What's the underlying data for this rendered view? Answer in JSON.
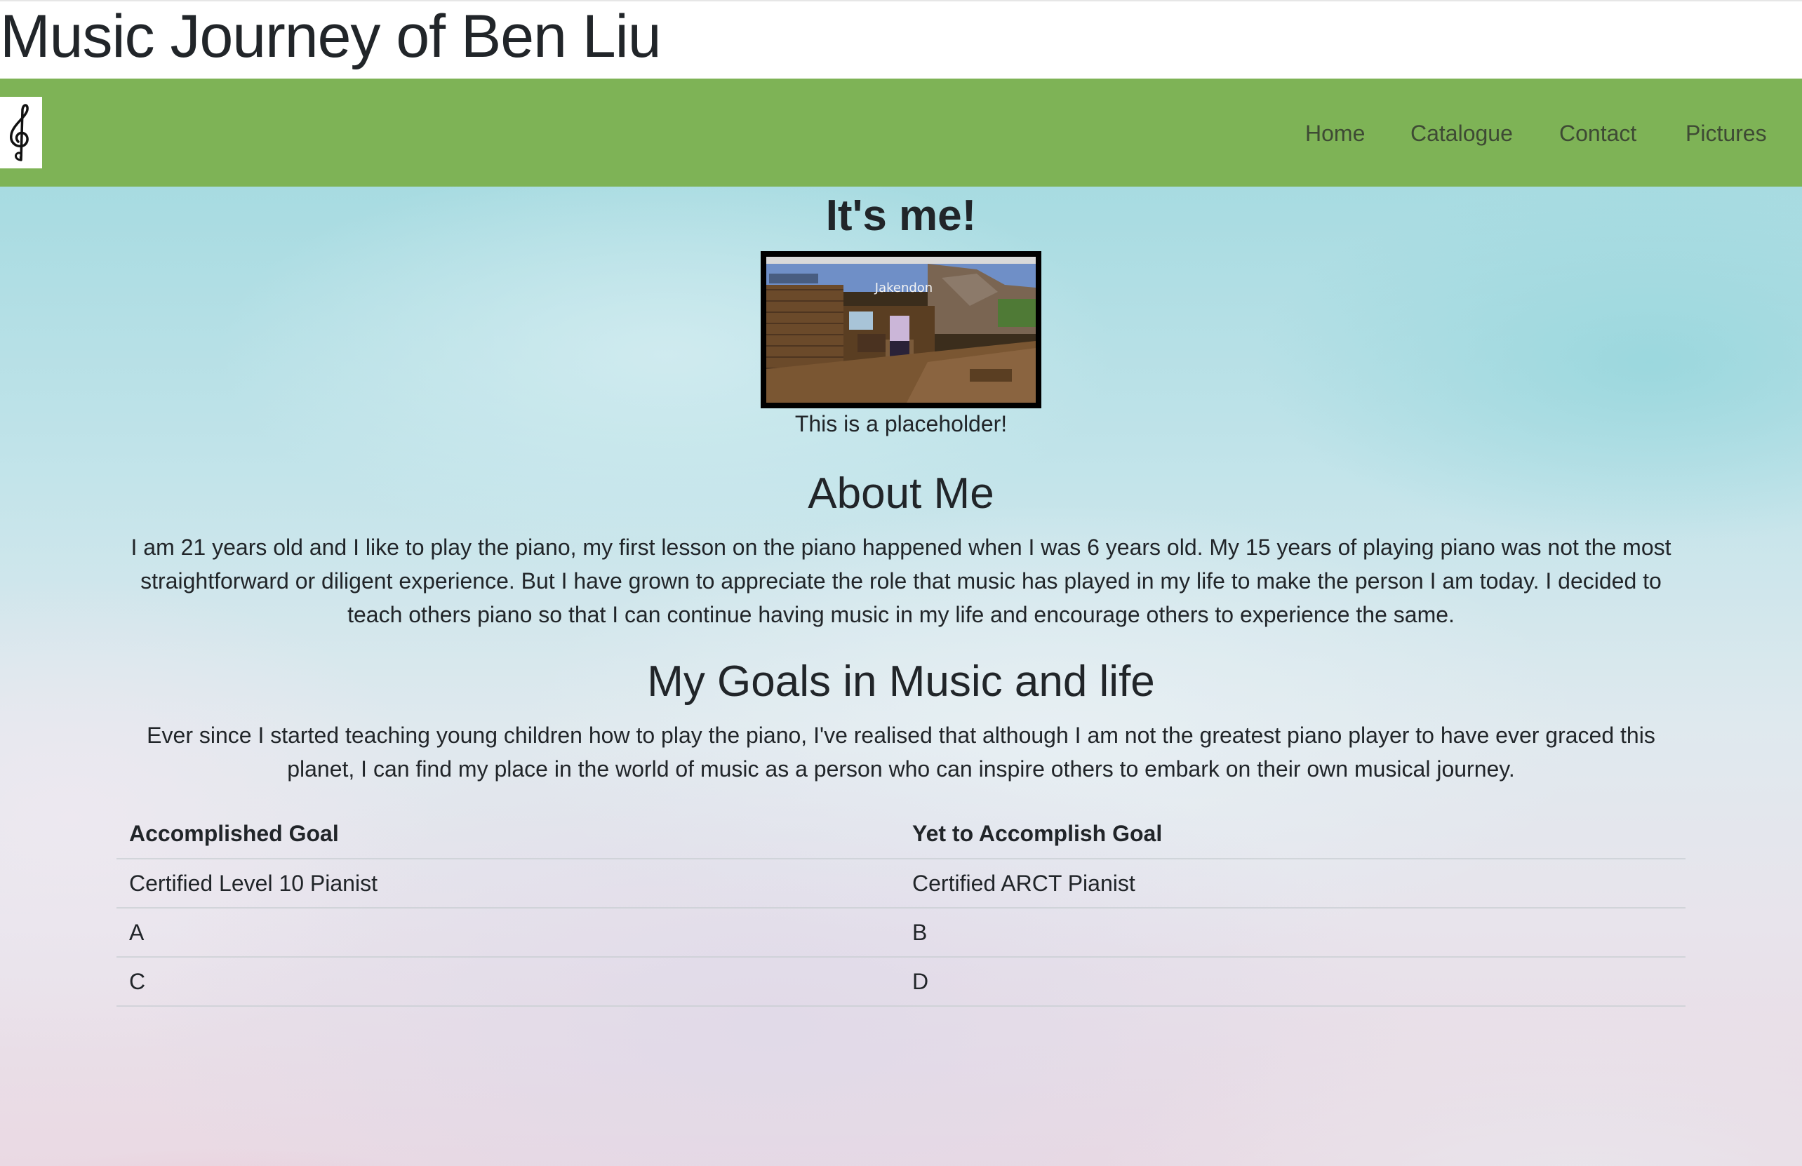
{
  "header": {
    "title": "Music Journey of Ben Liu"
  },
  "nav": {
    "logo_icon": "treble-clef-icon",
    "items": [
      {
        "label": "Home"
      },
      {
        "label": "Catalogue"
      },
      {
        "label": "Contact"
      },
      {
        "label": "Pictures"
      }
    ],
    "background_color": "#7eb356"
  },
  "hero": {
    "heading": "It's me!",
    "photo_overlay_text": "Jakendon",
    "caption": "This is a placeholder!"
  },
  "about": {
    "heading": "About Me",
    "text": "I am 21 years old and I like to play the piano, my first lesson on the piano happened when I was 6 years old. My 15 years of playing piano was not the most straightforward or diligent experience. But I have grown to appreciate the role that music has played in my life to make the person I am today. I decided to teach others piano so that I can continue having music in my life and encourage others to experience the same."
  },
  "goals": {
    "heading": "My Goals in Music and life",
    "text": "Ever since I started teaching young children how to play the piano, I've realised that although I am not the greatest piano player to have ever graced this planet, I can find my place in the world of music as a person who can inspire others to embark on their own musical journey.",
    "table": {
      "headers": [
        "Accomplished Goal",
        "Yet to Accomplish Goal"
      ],
      "rows": [
        [
          "Certified Level 10 Pianist",
          "Certified ARCT Pianist"
        ],
        [
          "A",
          "B"
        ],
        [
          "C",
          "D"
        ]
      ]
    }
  }
}
